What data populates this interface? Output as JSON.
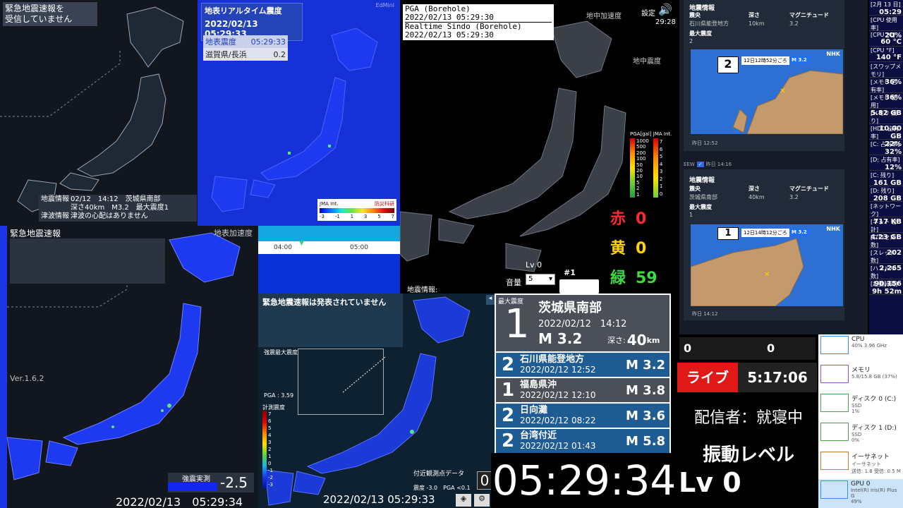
{
  "p1": {
    "title": "緊急地震速報を\n受信していません",
    "info_label": "地震情報",
    "info_line1": "02/12　14:12　茨城県南部",
    "info_line2": "深さ40km　M3.2　最大震度1",
    "tsunami_label": "津波情報",
    "tsunami_text": "津波の心配はありません"
  },
  "p2": {
    "title": "地表リアルタイム震度",
    "time": "2022/02/13 05:29:33",
    "sub_label": "地表震度",
    "sub_time": "05:29:33",
    "station": "滋賀県/長浜",
    "station_val": "0.2",
    "brand": "EdMini",
    "scale_label": "JMA Int.",
    "org": "防災科研",
    "scale_ticks": [
      "-3",
      "-1",
      "1",
      "3",
      "5",
      "7"
    ]
  },
  "p3": {
    "pga": "PGA (Borehole)",
    "pga_time": "2022/02/13 05:29:30",
    "rs": "Realtime Sindo (Borehole)",
    "rs_time": "2022/02/13 05:29:30",
    "label_accel": "地中加速度",
    "label_sindo": "地中震度",
    "setting": "設定",
    "clock": "29:28",
    "legend_head": "PGA[gal] JMA Int.",
    "pga_ticks": [
      "1000",
      "500",
      "200",
      "100",
      "50",
      "20",
      "10",
      "5",
      "2",
      "1"
    ],
    "int_ticks": [
      "7",
      "6",
      "5",
      "4",
      "3",
      "2",
      "1",
      "0"
    ],
    "red_label": "赤",
    "red_val": "0",
    "yellow_label": "黄",
    "yellow_val": "0",
    "green_label": "緑",
    "green_val": "59",
    "lv": "Lv 0",
    "vol_label": "音量",
    "vol_val": "5",
    "num": "#1",
    "info": "地震情報:"
  },
  "p4": {
    "title": "緊急地震速報",
    "sub": "地表加速度",
    "ver": "Ver.1.6.2",
    "meter_label": "強震実測",
    "meter_val": "-2.5",
    "time": "2022/02/13　05:29:34"
  },
  "p5": {
    "t1": "04:00",
    "t2": "05:00"
  },
  "p6": {
    "title": "緊急地震速報は発表されていません",
    "sub": "強震最大震度",
    "pga": "PGA : 3.59",
    "scale_label": "計測震度",
    "ticks": [
      "7",
      "6",
      "5",
      "4",
      "3",
      "2",
      "1",
      "0",
      "-1",
      "-2",
      "-3"
    ],
    "station": "付近観測点データ",
    "station_val": "0",
    "station_line": "震度 -3.0　PGA <0.1",
    "time": "2022/02/13 05:29:33"
  },
  "p7": {
    "max_label": "最大震度",
    "max_int": "1",
    "region": "茨城県南部",
    "datetime": "2022/02/12　14:12",
    "mag": "M 3.2",
    "depth_label": "深さ:",
    "depth_val": "40",
    "depth_unit": "km",
    "rows": [
      {
        "int": "2",
        "region": "石川県能登地方",
        "date": "2022/02/12 12:52",
        "mag": "M 3.2"
      },
      {
        "int": "1",
        "region": "福島県沖",
        "date": "2022/02/12 12:10",
        "mag": "M 3.8"
      },
      {
        "int": "2",
        "region": "日向灘",
        "date": "2022/02/12 08:22",
        "mag": "M 3.6"
      },
      {
        "int": "2",
        "region": "台湾付近",
        "date": "2022/02/12 01:43",
        "mag": "M 5.8"
      }
    ]
  },
  "clock": {
    "time": "05:29:34",
    "lv": "Lv 0"
  },
  "p8": {
    "card1": {
      "head": "地震情報",
      "c1": "震央",
      "c2": "深さ",
      "c3": "マグニチュード",
      "v1": "石川県能登地方",
      "v2": "10km",
      "v3": "3.2",
      "max_label": "最大震度",
      "max_val": "2",
      "nhk": "NHK",
      "map_int": "2",
      "map_text": "12日12時52分ごろ",
      "map_mag": "M 3.2",
      "foot": "昨日 12:52"
    },
    "eew": "EEW",
    "eew_time": "昨日 14:16",
    "card2": {
      "head": "地震情報",
      "c1": "震央",
      "c2": "深さ",
      "c3": "マグニチュード",
      "v1": "茨城県南部",
      "v2": "40km",
      "v3": "3.2",
      "max_label": "最大震度",
      "max_val": "1",
      "nhk": "NHK",
      "map_int": "1",
      "map_text": "12日14時12分ごろ",
      "map_mag": "M 3.2",
      "foot": "昨日 14:12"
    }
  },
  "counts": {
    "left": "0",
    "right": "0"
  },
  "live": {
    "label": "ライブ",
    "time": "5:17:06",
    "streamer": "配信者：就寝中",
    "shindo": "振動レベル"
  },
  "sys": [
    {
      "k": "[2月 13 日]",
      "v": "05:29"
    },
    {
      "k": "[CPU 使用率]",
      "v": "20%"
    },
    {
      "k": "[CPU °C]",
      "v": "60 °C"
    },
    {
      "k": "[CPU °F]",
      "v": "140 °F"
    },
    {
      "k": "[スワップメモリ]",
      "v": "36%"
    },
    {
      "k": "[メモリ 占有率]",
      "v": "36%"
    },
    {
      "k": "[メモリ 使用]",
      "v": "5.82 GB"
    },
    {
      "k": "[メモリ 残り]",
      "v": "10.00 GB"
    },
    {
      "k": "[HDD 占有率]",
      "v": "22%"
    },
    {
      "k": "[C: 占有率]",
      "v": "32%"
    },
    {
      "k": "[D: 占有率]",
      "v": "12%"
    },
    {
      "k": "[C: 残り]",
      "v": "161 GB"
    },
    {
      "k": "[D: 残り]",
      "v": "208 GB"
    },
    {
      "k": "[ネットワーク]",
      "v": "717 KB"
    },
    {
      "k": "[ネット 合計]",
      "v": "4.23 GB"
    },
    {
      "k": "[プロセス数]",
      "v": "202"
    },
    {
      "k": "[スレッド数]",
      "v": "2,265"
    },
    {
      "k": "[ハンドル数]",
      "v": "90,156"
    },
    {
      "k": "[起動時間]",
      "v": "9h 52m"
    }
  ],
  "task": [
    {
      "name": "CPU",
      "detail": "40%  3.96 GHz",
      "color": "#3d8de0"
    },
    {
      "name": "メモリ",
      "detail": "5.8/15.8 GB (37%)",
      "color": "#9b4fc9"
    },
    {
      "name": "ディスク 0 (C:)",
      "detail": "SSD\n1%",
      "color": "#4aa34a"
    },
    {
      "name": "ディスク 1 (D:)",
      "detail": "SSD\n0%",
      "color": "#4aa34a"
    },
    {
      "name": "イーサネット",
      "detail": "イーサネット\n送信: 1.8  受信: 0.5 M",
      "color": "#c47b2d"
    },
    {
      "name": "GPU 0",
      "detail": "Intel(R) Iris(R) Plus G\n49%",
      "color": "#3d8de0"
    }
  ]
}
